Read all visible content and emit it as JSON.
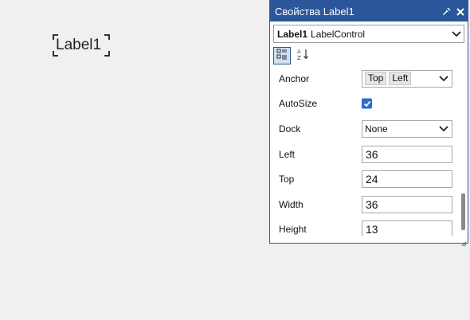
{
  "canvas": {
    "label_text": "Label1"
  },
  "panel": {
    "title": "Свойства Label1",
    "object_selector": {
      "name": "Label1",
      "type": "LabelControl"
    },
    "toolbar": {
      "categorized": "categorized-view-icon",
      "alphabetical": "alphabetical-sort-icon"
    },
    "properties": {
      "anchor": {
        "label": "Anchor",
        "values": [
          "Top",
          "Left"
        ]
      },
      "autosize": {
        "label": "AutoSize",
        "checked": true
      },
      "dock": {
        "label": "Dock",
        "value": "None"
      },
      "left": {
        "label": "Left",
        "value": "36"
      },
      "top": {
        "label": "Top",
        "value": "24"
      },
      "width": {
        "label": "Width",
        "value": "36"
      },
      "height": {
        "label": "Height",
        "value": "13"
      }
    }
  },
  "colors": {
    "accent": "#2b579a",
    "checkbox": "#2b6cd0",
    "background": "#f0f0f0"
  }
}
